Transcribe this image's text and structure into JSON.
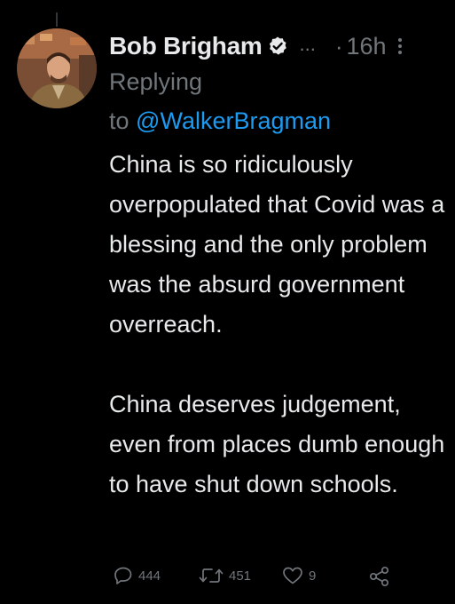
{
  "tweet": {
    "author_name": "Bob Brigham",
    "verified_icon": "verified-badge-icon",
    "name_truncation": "...",
    "time_separator": "·",
    "timestamp": "16h",
    "more_icon": "more-vertical-icon",
    "replying_label": "Replying",
    "replying_to_prefix": "to",
    "replying_to_handle": "@WalkerBragman",
    "body_paragraphs": [
      "China is so ridiculously overpopulated that Covid was a blessing and the only problem was the absurd government overreach.",
      "China deserves judgement, even from places dumb enough to have shut down schools."
    ]
  },
  "actions": {
    "reply_count": "444",
    "retweet_count": "451",
    "like_count": "9"
  },
  "colors": {
    "background": "#000000",
    "primary_text": "#e7e9ea",
    "secondary_text": "#71767b",
    "link": "#1d9bf0",
    "thread_line": "#333639"
  }
}
